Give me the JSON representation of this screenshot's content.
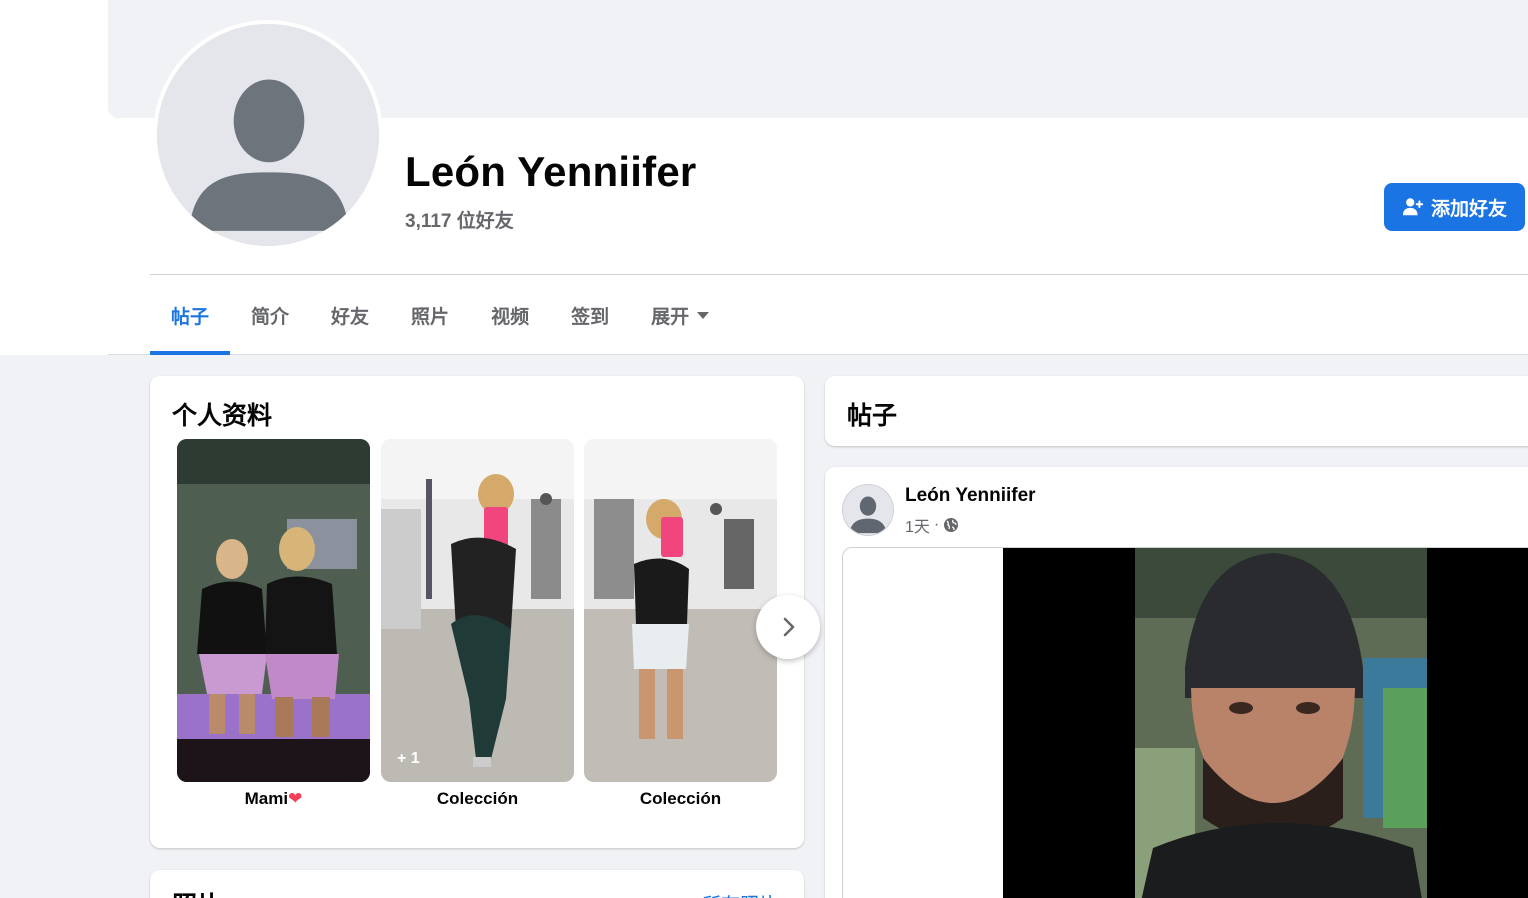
{
  "profile": {
    "name": "León Yenniifer",
    "friend_count": "3,117 位好友",
    "add_friend_label": "添加好友"
  },
  "tabs": [
    {
      "label": "帖子",
      "active": true
    },
    {
      "label": "简介"
    },
    {
      "label": "好友"
    },
    {
      "label": "照片"
    },
    {
      "label": "视频"
    },
    {
      "label": "签到"
    },
    {
      "label": "展开"
    }
  ],
  "intro": {
    "title": "个人资料",
    "featured": [
      {
        "label": "Mami",
        "emoji": "❤"
      },
      {
        "label": "Colección",
        "extra": "+ 1"
      },
      {
        "label": "Colección"
      }
    ]
  },
  "photos": {
    "title": "照片",
    "link": "所有照片"
  },
  "posts": {
    "header": "帖子",
    "items": [
      {
        "author": "León Yenniifer",
        "time": "1天",
        "separator": "·",
        "audience_icon": "globe-icon"
      }
    ]
  },
  "colors": {
    "accent": "#1b74e4",
    "background": "#f0f2f5",
    "secondary_text": "#65676b",
    "heart": "#f33e58"
  }
}
